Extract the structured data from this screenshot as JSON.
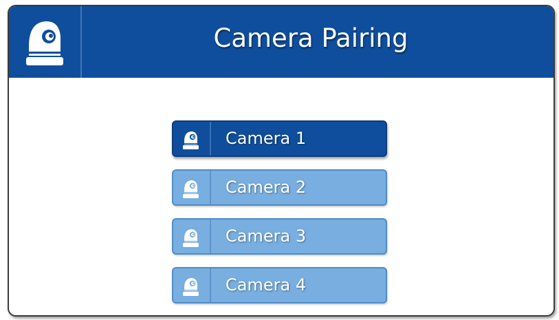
{
  "header": {
    "title": "Camera Pairing",
    "icon": "camera-icon",
    "color": "#0f4e9c"
  },
  "cameras": [
    {
      "label": "Camera 1",
      "selected": true
    },
    {
      "label": "Camera 2",
      "selected": false
    },
    {
      "label": "Camera 3",
      "selected": false
    },
    {
      "label": "Camera 4",
      "selected": false
    }
  ],
  "colors": {
    "active": "#0f4e9c",
    "inactive": "#78aee0",
    "text": "#ffffff"
  }
}
